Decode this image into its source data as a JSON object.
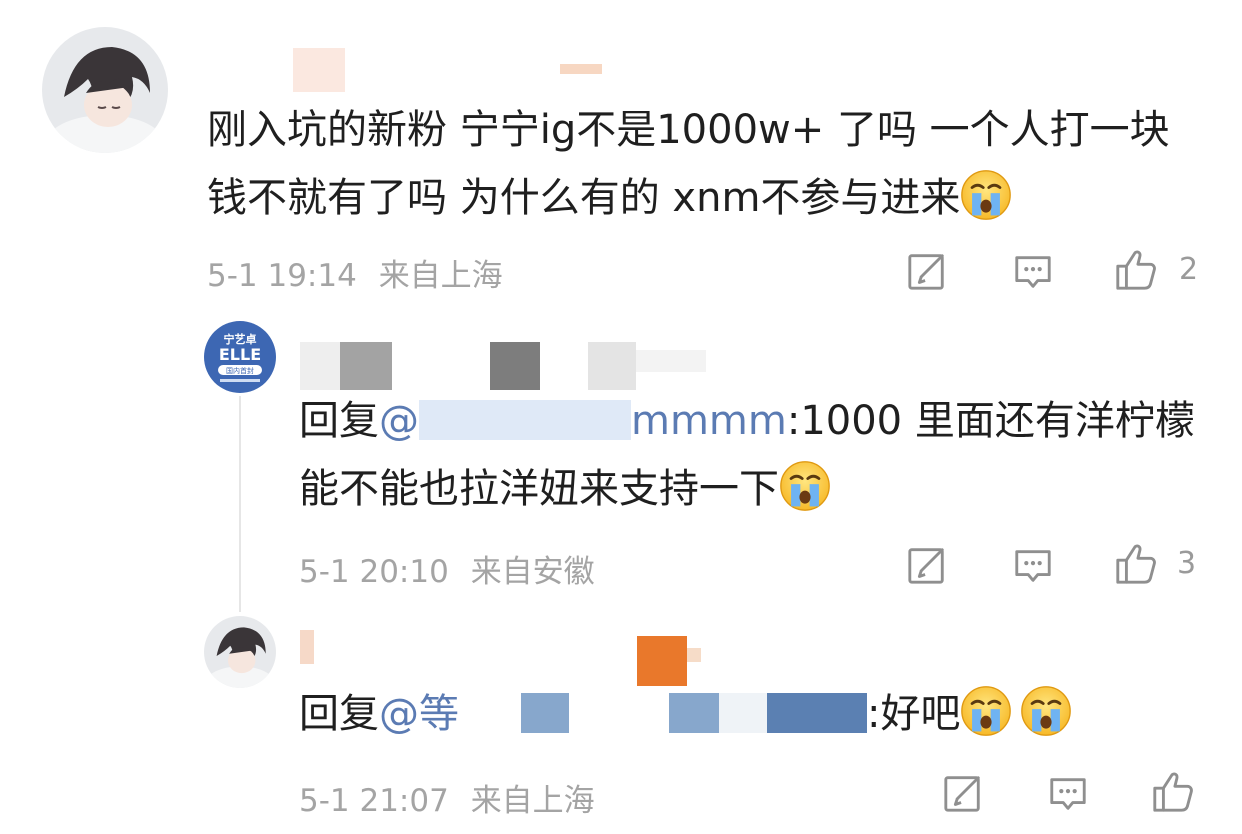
{
  "comments": [
    {
      "text": "刚入坑的新粉 宁宁ig不是1000w+ 了吗 一个人打一块钱不就有了吗 为什么有的 xnm不参与进来",
      "time": "5-1 19:14",
      "location": "来自上海",
      "likes": "2"
    }
  ],
  "replies": [
    {
      "prefix": "回复",
      "mention_at": "@",
      "mention_tail": "mmmm",
      "text": ":1000 里面还有洋柠檬 能不能也拉洋妞来支持一下",
      "time": "5-1 20:10",
      "location": "来自安徽",
      "likes": "3",
      "avatar_badge": {
        "line1": "宁艺卓",
        "line2": "ELLE",
        "line3": "国内首封"
      }
    },
    {
      "prefix": "回复",
      "mention_at": "@等",
      "text": ":好吧",
      "time": "5-1 21:07",
      "location": "来自上海"
    }
  ],
  "icons": {
    "share": "share-edit-icon",
    "comment": "comment-icon",
    "like": "thumbs-up-icon",
    "emoji": "crying-face-emoji"
  },
  "colors": {
    "mention": "#5b7bb3",
    "meta": "#a4a4a4",
    "icon": "#8f8f8f"
  }
}
